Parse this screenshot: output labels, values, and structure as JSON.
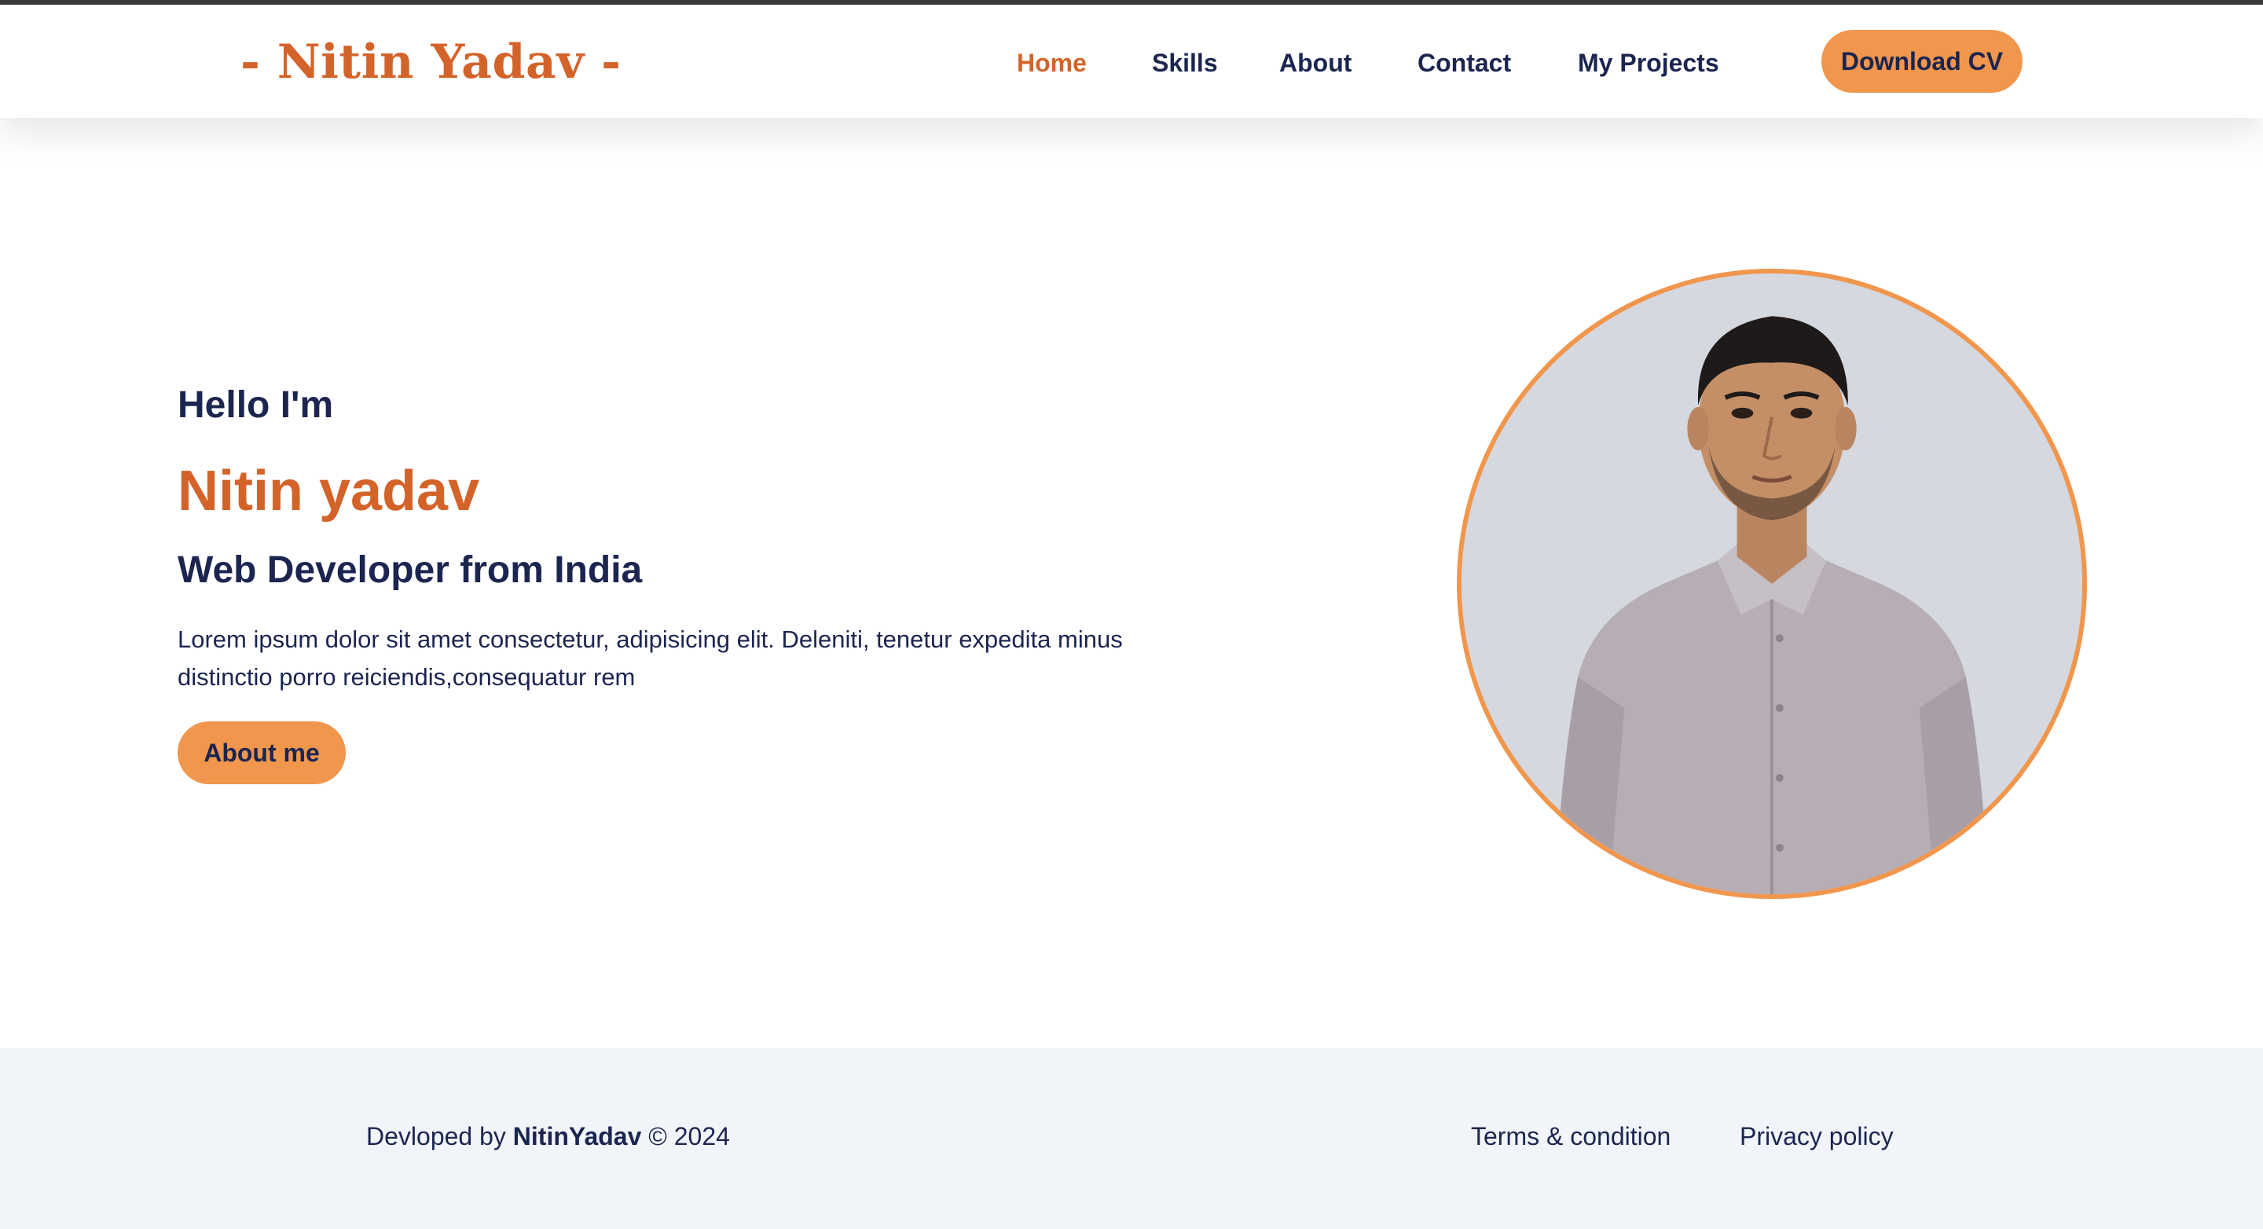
{
  "header": {
    "logo": "- Nitin Yadav -",
    "nav": [
      {
        "label": "Home"
      },
      {
        "label": "Skills"
      },
      {
        "label": "About"
      },
      {
        "label": "Contact"
      },
      {
        "label": "My Projects"
      }
    ],
    "cv_button": "Download CV"
  },
  "hero": {
    "greeting": "Hello I'm",
    "name": "Nitin yadav",
    "role": "Web Developer from India",
    "description": "Lorem ipsum dolor sit amet consectetur, adipisicing elit. Deleniti, tenetur expedita minus distinctio porro reiciendis,consequatur rem",
    "about_button": "About me"
  },
  "footer": {
    "credit_prefix": "Devloped by",
    "credit_name": "NitinYadav",
    "credit_suffix": "© 2024",
    "links": [
      {
        "label": "Terms & condition"
      },
      {
        "label": "Privacy policy"
      }
    ]
  },
  "colors": {
    "accent": "#d4632a",
    "button": "#f0964d",
    "text": "#1b2550",
    "footer_bg": "#f1f5f9"
  }
}
